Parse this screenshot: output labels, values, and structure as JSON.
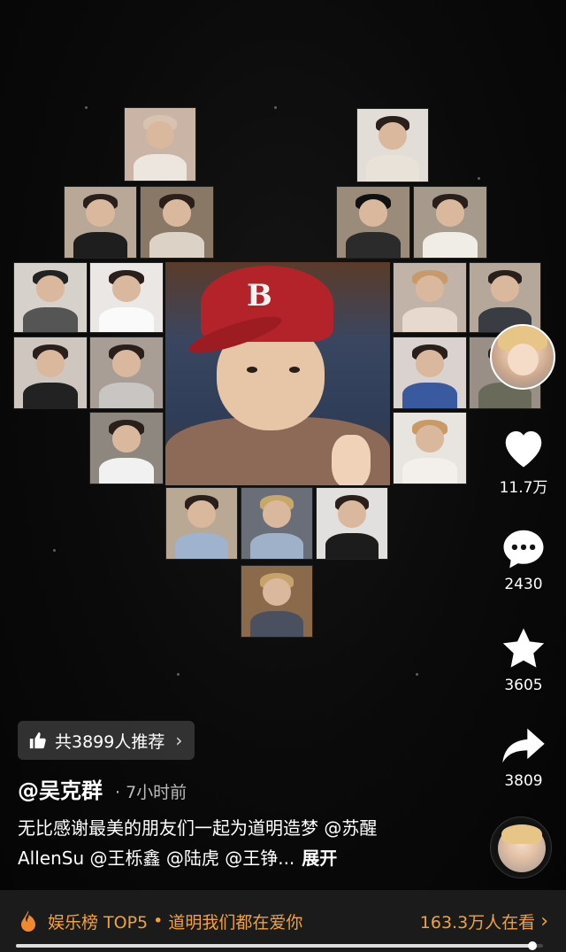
{
  "video": {
    "cap_letter": "B"
  },
  "sidebar": {
    "like_count": "11.7万",
    "comment_count": "2430",
    "favorite_count": "3605",
    "share_count": "3809"
  },
  "recommend": {
    "label": "共3899人推荐"
  },
  "post": {
    "author": "@吴克群",
    "time": "· 7小时前",
    "caption": "无比感谢最美的朋友们一起为道明造梦 @苏醒 AllenSu @王栎鑫 @陆虎 @王铮...",
    "expand_label": "展开"
  },
  "bottom_bar": {
    "rank_label": "娱乐榜 TOP5",
    "separator": "•",
    "topic": "道明我们都在爱你",
    "viewers": "163.3万人在看"
  },
  "progress": {
    "value": 0.98
  },
  "colors": {
    "accent_orange": "#f2a23a",
    "plus_red": "#fe2c55"
  }
}
